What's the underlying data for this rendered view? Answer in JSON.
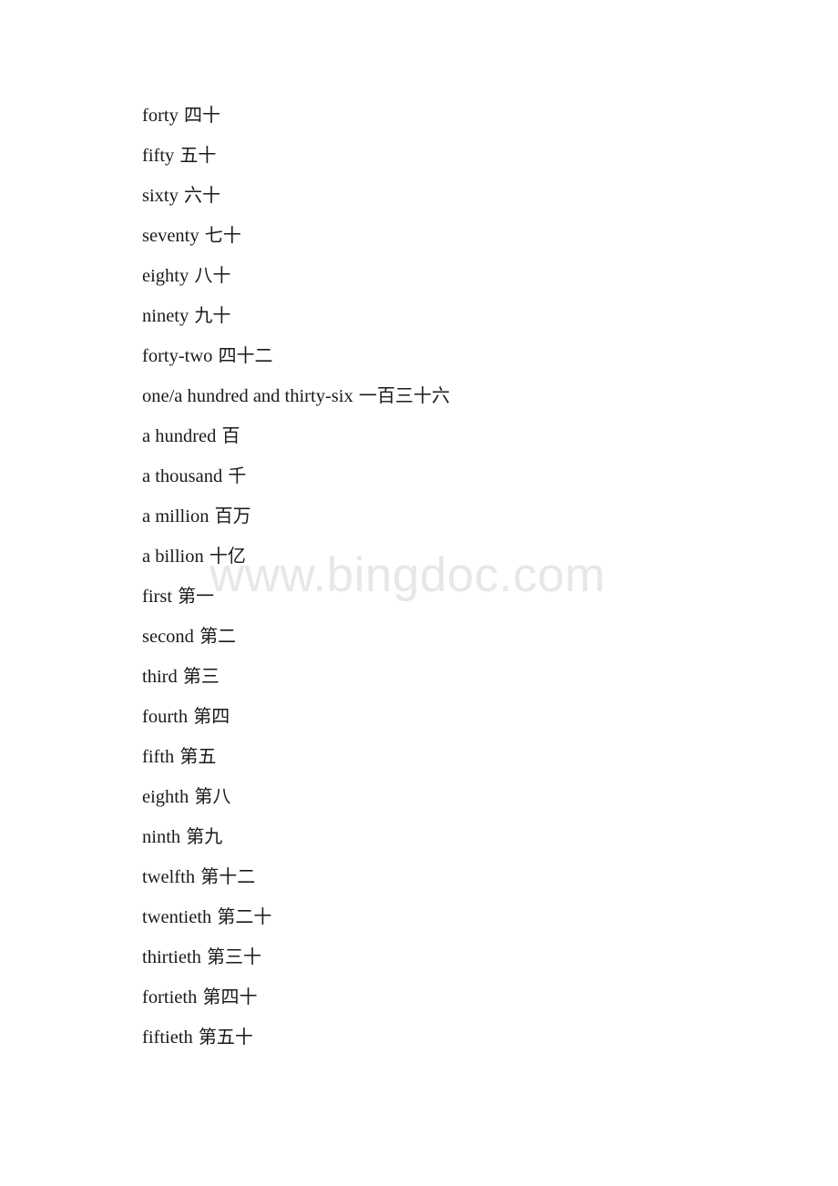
{
  "page": {
    "background_color": "#ffffff",
    "text_color": "#1a1a1a"
  },
  "watermark": {
    "text": "www.bingdoc.com",
    "color": "#e7e7e7"
  },
  "content": {
    "lines": [
      {
        "en": "forty",
        "zh": "四十"
      },
      {
        "en": "fifty",
        "zh": "五十"
      },
      {
        "en": "sixty",
        "zh": "六十"
      },
      {
        "en": "seventy",
        "zh": "七十"
      },
      {
        "en": "eighty",
        "zh": "八十"
      },
      {
        "en": "ninety",
        "zh": "九十"
      },
      {
        "en": "forty-two",
        "zh": "四十二"
      },
      {
        "en": "one/a hundred and thirty-six",
        "zh": "一百三十六"
      },
      {
        "en": "a hundred",
        "zh": "百"
      },
      {
        "en": "a thousand",
        "zh": "千"
      },
      {
        "en": "a million",
        "zh": "百万"
      },
      {
        "en": "a billion",
        "zh": "十亿"
      },
      {
        "en": "first",
        "zh": "第一"
      },
      {
        "en": "second",
        "zh": "第二"
      },
      {
        "en": "third",
        "zh": "第三"
      },
      {
        "en": "fourth",
        "zh": "第四"
      },
      {
        "en": "fifth",
        "zh": "第五"
      },
      {
        "en": "eighth",
        "zh": "第八"
      },
      {
        "en": "ninth",
        "zh": "第九"
      },
      {
        "en": "twelfth",
        "zh": "第十二"
      },
      {
        "en": "twentieth",
        "zh": "第二十"
      },
      {
        "en": "thirtieth",
        "zh": "第三十"
      },
      {
        "en": "fortieth",
        "zh": "第四十"
      },
      {
        "en": "fiftieth",
        "zh": "第五十"
      }
    ]
  }
}
